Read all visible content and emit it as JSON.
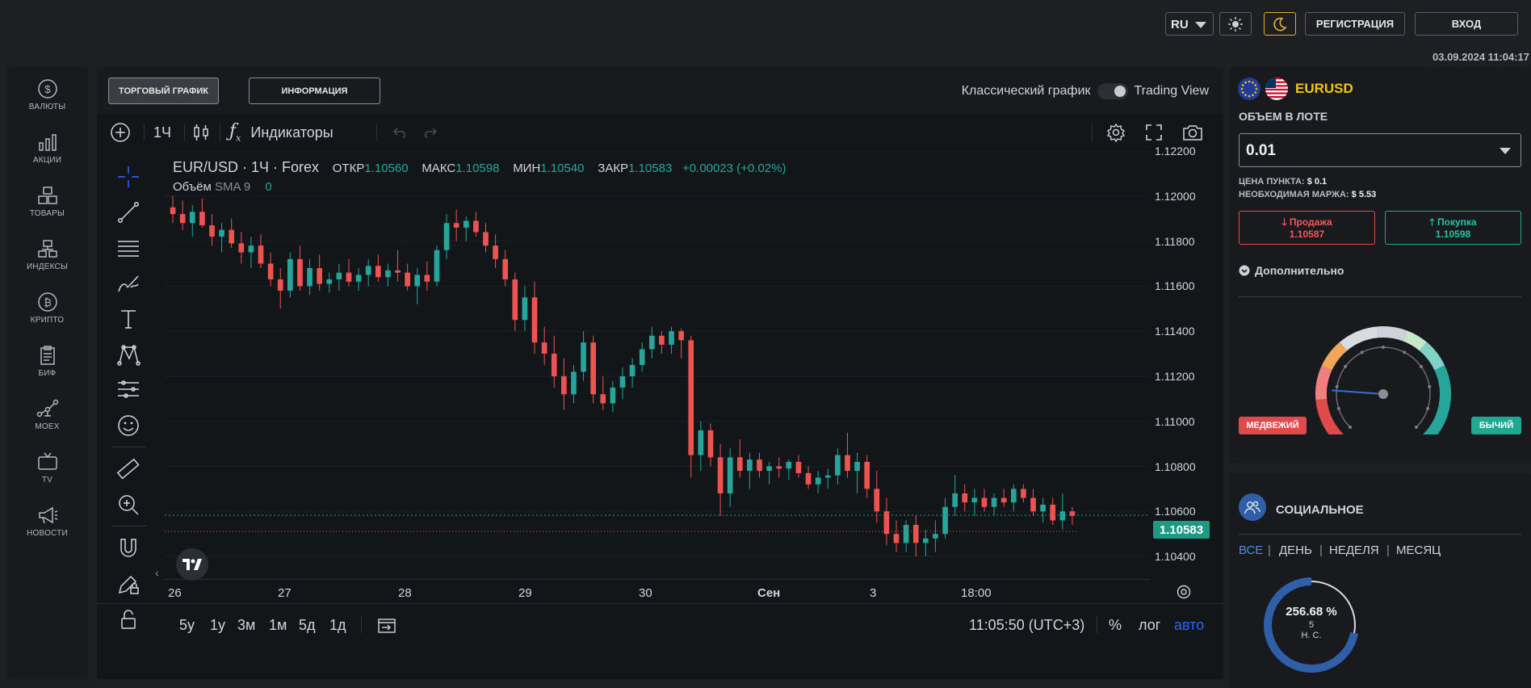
{
  "topbar": {
    "language": "RU",
    "register_label": "РЕГИСТРАЦИЯ",
    "login_label": "ВХОД",
    "datetime": "03.09.2024 11:04:17"
  },
  "sidebar": {
    "items": [
      {
        "label": "ВАЛЮТЫ",
        "icon": "dollar-coin-icon"
      },
      {
        "label": "АКЦИИ",
        "icon": "bar-chart-icon"
      },
      {
        "label": "ТОВАРЫ",
        "icon": "boxes-icon"
      },
      {
        "label": "ИНДЕКСЫ",
        "icon": "index-icon"
      },
      {
        "label": "КРИПТО",
        "icon": "bitcoin-icon"
      },
      {
        "label": "БИФ",
        "icon": "document-icon"
      },
      {
        "label": "MOEX",
        "icon": "network-icon"
      },
      {
        "label": "TV",
        "icon": "tv-icon"
      },
      {
        "label": "НОВОСТИ",
        "icon": "megaphone-icon"
      }
    ]
  },
  "main": {
    "tabs": [
      {
        "label": "ТОРГОВЫЙ ГРАФИК",
        "active": true
      },
      {
        "label": "ИНФОРМАЦИЯ",
        "active": false
      }
    ],
    "classic_label": "Классический график",
    "tradingview_label": "Trading View"
  },
  "tv": {
    "interval": "1Ч",
    "indicators_label": "Индикаторы",
    "symbol_line": "EUR/USD · 1Ч · Forex",
    "ohlc": {
      "open_label": "ОТКР",
      "open": "1.10560",
      "high_label": "МАКС",
      "high": "1.10598",
      "low_label": "МИН",
      "low": "1.10540",
      "close_label": "ЗАКР",
      "close": "1.10583",
      "change": "+0.00023 (+0.02%)"
    },
    "volume_label": "Объём",
    "sma_label": "SMA 9",
    "volume_value": "0",
    "last_price": "1.10583",
    "ranges": [
      "5y",
      "1y",
      "3м",
      "1м",
      "5д",
      "1д"
    ],
    "clock": "11:05:50 (UTC+3)",
    "percent_label": "%",
    "log_label": "лог",
    "auto_label": "авто",
    "accent_color": "#2962ff"
  },
  "chart_data": {
    "type": "candlestick",
    "price_ticks": [
      "1.12200",
      "1.12000",
      "1.11800",
      "1.11600",
      "1.11400",
      "1.11200",
      "1.11000",
      "1.10800",
      "1.10600",
      "1.10400"
    ],
    "time_ticks": [
      "26",
      "27",
      "28",
      "29",
      "30",
      "Сен",
      "3",
      "18:00"
    ],
    "ylim": [
      1.103,
      1.122
    ],
    "up_color": "#26a69a",
    "down_color": "#ef5350",
    "candles": [
      [
        1.1195,
        1.12,
        1.1188,
        1.1192
      ],
      [
        1.1192,
        1.1198,
        1.1185,
        1.1188
      ],
      [
        1.1188,
        1.1196,
        1.1182,
        1.1193
      ],
      [
        1.1193,
        1.1199,
        1.1186,
        1.1187
      ],
      [
        1.1187,
        1.1192,
        1.1178,
        1.1182
      ],
      [
        1.1182,
        1.1188,
        1.1175,
        1.1185
      ],
      [
        1.1185,
        1.119,
        1.1177,
        1.1179
      ],
      [
        1.1179,
        1.1184,
        1.117,
        1.1175
      ],
      [
        1.1175,
        1.1182,
        1.1168,
        1.1178
      ],
      [
        1.1178,
        1.1183,
        1.1168,
        1.117
      ],
      [
        1.117,
        1.1175,
        1.116,
        1.1163
      ],
      [
        1.1163,
        1.1168,
        1.115,
        1.1158
      ],
      [
        1.1158,
        1.1175,
        1.1155,
        1.1172
      ],
      [
        1.1172,
        1.1178,
        1.1158,
        1.116
      ],
      [
        1.116,
        1.1172,
        1.1156,
        1.1168
      ],
      [
        1.1168,
        1.1174,
        1.1158,
        1.1161
      ],
      [
        1.1161,
        1.1166,
        1.1157,
        1.1163
      ],
      [
        1.1163,
        1.117,
        1.1158,
        1.1166
      ],
      [
        1.1166,
        1.1172,
        1.116,
        1.1162
      ],
      [
        1.1162,
        1.1168,
        1.1158,
        1.1165
      ],
      [
        1.1165,
        1.1172,
        1.116,
        1.1169
      ],
      [
        1.1169,
        1.1174,
        1.1162,
        1.1164
      ],
      [
        1.1164,
        1.117,
        1.116,
        1.1167
      ],
      [
        1.1167,
        1.1176,
        1.1162,
        1.1166
      ],
      [
        1.1166,
        1.117,
        1.1158,
        1.116
      ],
      [
        1.116,
        1.1168,
        1.1152,
        1.1165
      ],
      [
        1.1165,
        1.1171,
        1.1158,
        1.1162
      ],
      [
        1.1162,
        1.1178,
        1.116,
        1.1176
      ],
      [
        1.1176,
        1.1192,
        1.1172,
        1.1188
      ],
      [
        1.1188,
        1.1194,
        1.118,
        1.1186
      ],
      [
        1.1186,
        1.1191,
        1.118,
        1.1189
      ],
      [
        1.1189,
        1.1193,
        1.1182,
        1.1184
      ],
      [
        1.1184,
        1.1188,
        1.1175,
        1.1178
      ],
      [
        1.1178,
        1.1183,
        1.1168,
        1.1172
      ],
      [
        1.1172,
        1.1176,
        1.116,
        1.1163
      ],
      [
        1.1163,
        1.1166,
        1.114,
        1.1145
      ],
      [
        1.1145,
        1.116,
        1.114,
        1.1155
      ],
      [
        1.1155,
        1.1162,
        1.113,
        1.1135
      ],
      [
        1.1135,
        1.1142,
        1.1125,
        1.113
      ],
      [
        1.113,
        1.1138,
        1.1115,
        1.112
      ],
      [
        1.112,
        1.1128,
        1.1105,
        1.1112
      ],
      [
        1.1112,
        1.1125,
        1.1108,
        1.1122
      ],
      [
        1.1122,
        1.114,
        1.1118,
        1.1135
      ],
      [
        1.1135,
        1.1138,
        1.1108,
        1.1112
      ],
      [
        1.1112,
        1.112,
        1.1105,
        1.1108
      ],
      [
        1.1108,
        1.1118,
        1.1104,
        1.1115
      ],
      [
        1.1115,
        1.1124,
        1.111,
        1.112
      ],
      [
        1.112,
        1.1128,
        1.1115,
        1.1125
      ],
      [
        1.1125,
        1.1135,
        1.1122,
        1.1132
      ],
      [
        1.1132,
        1.1142,
        1.1128,
        1.1138
      ],
      [
        1.1138,
        1.114,
        1.113,
        1.1134
      ],
      [
        1.1134,
        1.1142,
        1.113,
        1.114
      ],
      [
        1.114,
        1.1141,
        1.1128,
        1.1136
      ],
      [
        1.1136,
        1.1138,
        1.1075,
        1.1085
      ],
      [
        1.1085,
        1.11,
        1.1078,
        1.1096
      ],
      [
        1.1096,
        1.1099,
        1.108,
        1.1084
      ],
      [
        1.1084,
        1.109,
        1.1058,
        1.1068
      ],
      [
        1.1068,
        1.1088,
        1.1062,
        1.1084
      ],
      [
        1.1084,
        1.1092,
        1.1075,
        1.1078
      ],
      [
        1.1078,
        1.1086,
        1.107,
        1.1083
      ],
      [
        1.1083,
        1.1086,
        1.1075,
        1.1078
      ],
      [
        1.1078,
        1.1082,
        1.1072,
        1.108
      ],
      [
        1.108,
        1.1084,
        1.1075,
        1.1079
      ],
      [
        1.1079,
        1.1083,
        1.1074,
        1.1082
      ],
      [
        1.1082,
        1.1085,
        1.1075,
        1.1077
      ],
      [
        1.1077,
        1.108,
        1.107,
        1.1072
      ],
      [
        1.1072,
        1.1078,
        1.1068,
        1.1075
      ],
      [
        1.1075,
        1.1079,
        1.107,
        1.1076
      ],
      [
        1.1076,
        1.1088,
        1.1072,
        1.1085
      ],
      [
        1.1085,
        1.1095,
        1.1075,
        1.1078
      ],
      [
        1.1078,
        1.1086,
        1.1068,
        1.1082
      ],
      [
        1.1082,
        1.1085,
        1.1066,
        1.107
      ],
      [
        1.107,
        1.1078,
        1.1055,
        1.106
      ],
      [
        1.106,
        1.1066,
        1.1045,
        1.105
      ],
      [
        1.105,
        1.1056,
        1.1042,
        1.1046
      ],
      [
        1.1046,
        1.1056,
        1.1042,
        1.1054
      ],
      [
        1.1054,
        1.1058,
        1.104,
        1.1046
      ],
      [
        1.1046,
        1.1052,
        1.104,
        1.1048
      ],
      [
        1.1048,
        1.1056,
        1.1042,
        1.105
      ],
      [
        1.105,
        1.1066,
        1.1048,
        1.1062
      ],
      [
        1.1062,
        1.1076,
        1.1058,
        1.1068
      ],
      [
        1.1068,
        1.1072,
        1.106,
        1.1064
      ],
      [
        1.1064,
        1.107,
        1.1058,
        1.1066
      ],
      [
        1.1066,
        1.107,
        1.106,
        1.1062
      ],
      [
        1.1062,
        1.1068,
        1.1058,
        1.1066
      ],
      [
        1.1066,
        1.107,
        1.1062,
        1.1064
      ],
      [
        1.1064,
        1.1072,
        1.106,
        1.107
      ],
      [
        1.107,
        1.1072,
        1.1064,
        1.1066
      ],
      [
        1.1066,
        1.107,
        1.1058,
        1.106
      ],
      [
        1.106,
        1.1066,
        1.1055,
        1.1063
      ],
      [
        1.1063,
        1.1066,
        1.1054,
        1.1056
      ],
      [
        1.1056,
        1.1068,
        1.1052,
        1.106
      ],
      [
        1.106,
        1.1062,
        1.1054,
        1.1058
      ]
    ]
  },
  "right": {
    "pair": "EURUSD",
    "lot_title": "ОБЪЕМ В ЛОТЕ",
    "lot_value": "0.01",
    "point_price_label": "ЦЕНА ПУНКТА:",
    "point_price": "$ 0.1",
    "margin_label": "НЕОБХОДИМАЯ МАРЖА:",
    "margin": "$ 5.53",
    "sell_label": "Продажа",
    "sell_price": "1.10587",
    "buy_label": "Покупка",
    "buy_price": "1.10598",
    "more_label": "Дополнительно",
    "bear_label": "МЕДВЕЖИЙ",
    "bull_label": "БЫЧИЙ",
    "gauge_value": 0.33
  },
  "social": {
    "title": "СОЦИАЛЬНОЕ",
    "periods": [
      "ВСЕ",
      "ДЕНЬ",
      "НЕДЕЛЯ",
      "МЕСЯЦ"
    ],
    "active_period": "ВСЕ",
    "percent": "256.68 %",
    "count": "5",
    "unit": "Н. С.",
    "fill": 0.72
  }
}
